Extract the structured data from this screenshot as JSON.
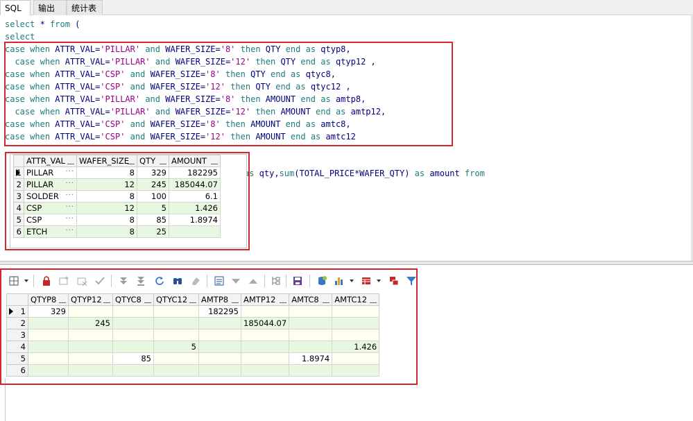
{
  "tabs": [
    {
      "label": "SQL",
      "active": true
    },
    {
      "label": "输出",
      "active": false
    },
    {
      "label": "统计表",
      "active": false
    }
  ],
  "editor": {
    "lines": [
      "select * from (",
      "select",
      "case when ATTR_VAL='PILLAR' and WAFER_SIZE='8' then QTY end as qtyp8,",
      "  case when ATTR_VAL='PILLAR' and WAFER_SIZE='12' then QTY end as qtyp12 ,",
      "case when ATTR_VAL='CSP' and WAFER_SIZE='8' then QTY end as qtyc8,",
      "case when ATTR_VAL='CSP' and WAFER_SIZE='12' then QTY end as qtyc12 ,",
      "case when ATTR_VAL='PILLAR' and WAFER_SIZE='8' then AMOUNT end as amtp8,",
      "  case when ATTR_VAL='PILLAR' and WAFER_SIZE='12' then AMOUNT end as amtp12,",
      "case when ATTR_VAL='CSP' and WAFER_SIZE='8' then AMOUNT end as amtc8,",
      "case when ATTR_VAL='CSP' and WAFER_SIZE='12' then AMOUNT end as amtc12"
    ],
    "partial_line": "as qty,sum(TOTAL_PRICE*WAFER_QTY) as amount from"
  },
  "source_grid": {
    "columns": [
      "ATTR_VAL",
      "WAFER_SIZE",
      "QTY",
      "AMOUNT"
    ],
    "rows": [
      {
        "n": "1",
        "attr": "PILLAR",
        "size": "8",
        "qty": "329",
        "amount": "182295"
      },
      {
        "n": "2",
        "attr": "PILLAR",
        "size": "12",
        "qty": "245",
        "amount": "185044.07"
      },
      {
        "n": "3",
        "attr": "SOLDER",
        "size": "8",
        "qty": "100",
        "amount": "6.1"
      },
      {
        "n": "4",
        "attr": "CSP",
        "size": "12",
        "qty": "5",
        "amount": "1.426"
      },
      {
        "n": "5",
        "attr": "CSP",
        "size": "8",
        "qty": "85",
        "amount": "1.8974"
      },
      {
        "n": "6",
        "attr": "ETCH",
        "size": "8",
        "qty": "25",
        "amount": ""
      }
    ],
    "ellipsis": "···"
  },
  "toolbar": {
    "icons": [
      "grid-select-icon",
      "lock-icon",
      "new-record-icon",
      "delete-record-icon",
      "post-check-icon",
      "fetch-next-icon",
      "fetch-last-icon",
      "refresh-icon",
      "find-icon",
      "clear-icon",
      "sql-editor-icon",
      "sort-down-icon",
      "sort-up-icon",
      "tree-icon",
      "save-icon",
      "query-icon",
      "chart-icon",
      "table-export-icon",
      "compare-icon",
      "filter-icon"
    ]
  },
  "result_grid": {
    "columns": [
      "QTYP8",
      "QTYP12",
      "QTYC8",
      "QTYC12",
      "AMTP8",
      "AMTP12",
      "AMTC8",
      "AMTC12"
    ],
    "rows": [
      {
        "n": "1",
        "cells": [
          "329",
          "",
          "",
          "",
          "182295",
          "",
          "",
          ""
        ]
      },
      {
        "n": "2",
        "cells": [
          "",
          "245",
          "",
          "",
          "",
          "185044.07",
          "",
          ""
        ]
      },
      {
        "n": "3",
        "cells": [
          "",
          "",
          "",
          "",
          "",
          "",
          "",
          ""
        ]
      },
      {
        "n": "4",
        "cells": [
          "",
          "",
          "",
          "5",
          "",
          "",
          "",
          "1.426"
        ]
      },
      {
        "n": "5",
        "cells": [
          "",
          "",
          "85",
          "",
          "",
          "",
          "1.8974",
          ""
        ]
      },
      {
        "n": "6",
        "cells": [
          "",
          "",
          "",
          "",
          "",
          "",
          "",
          ""
        ]
      }
    ]
  },
  "colors": {
    "accent_red": "#d9262b",
    "keyword_blue": "#00007f",
    "string_purple": "#9a0088",
    "even_row": "#e8f8e0"
  }
}
